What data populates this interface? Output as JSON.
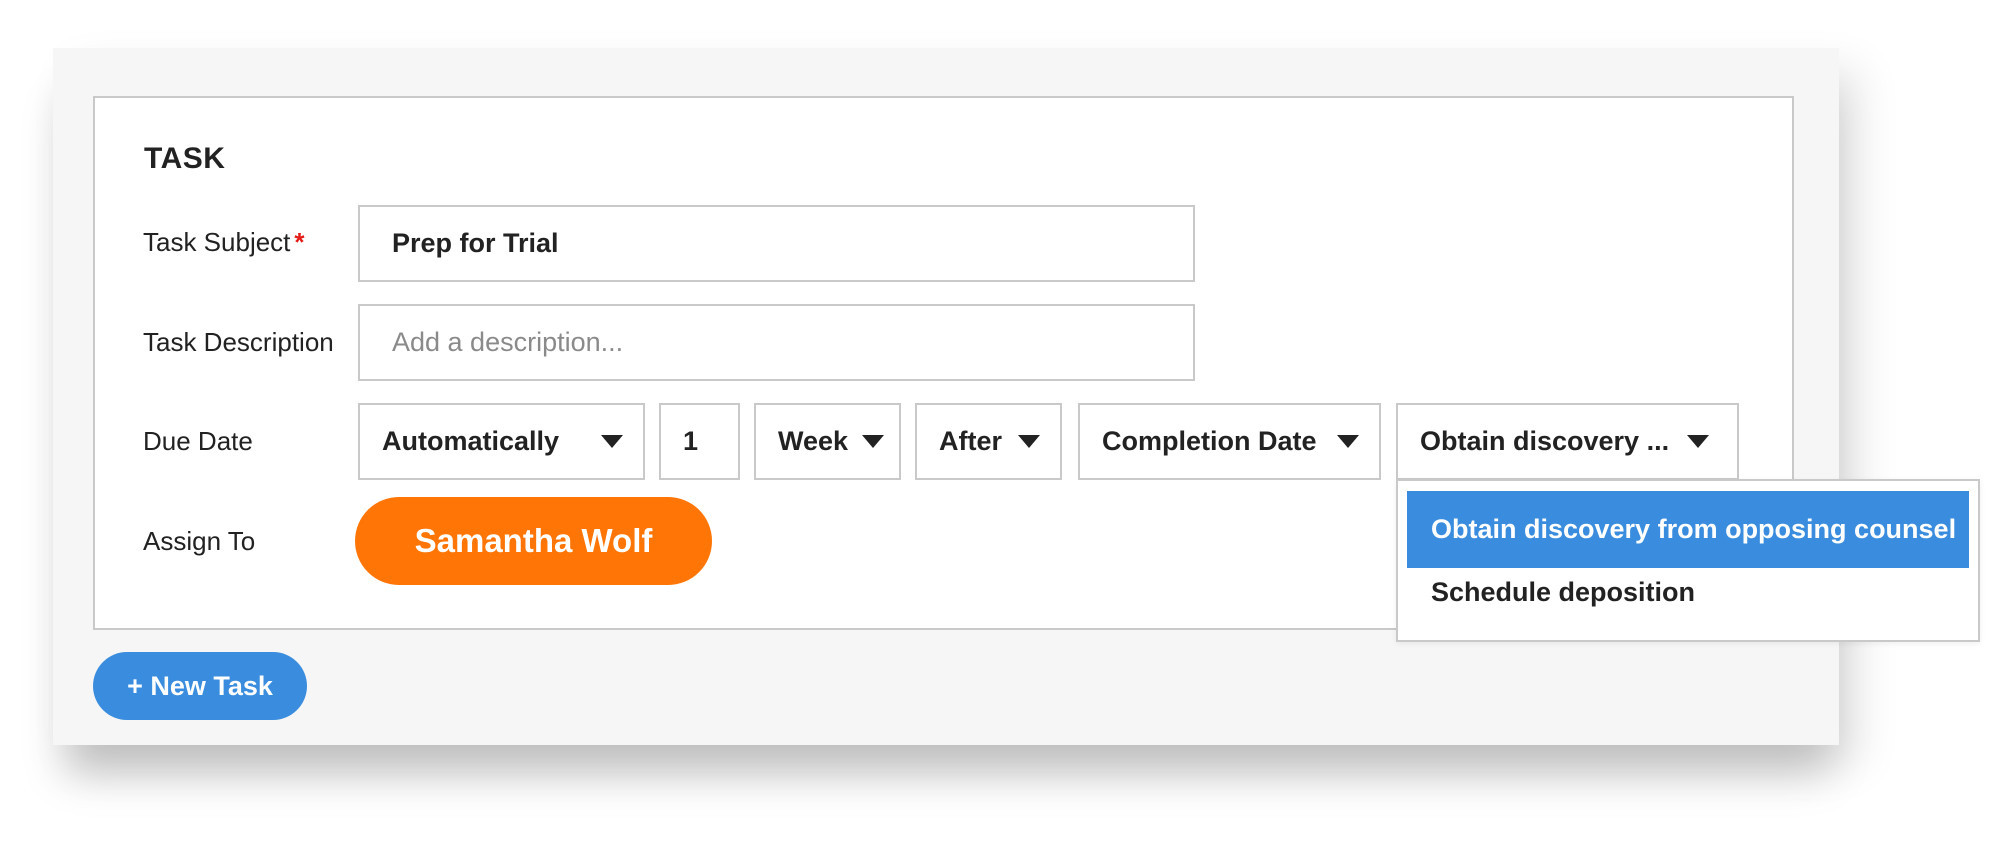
{
  "section_title": "TASK",
  "fields": {
    "subject": {
      "label": "Task Subject",
      "required_marker": "*",
      "value": "Prep for Trial"
    },
    "description": {
      "label": "Task Description",
      "value": "",
      "placeholder": "Add a description..."
    },
    "due_date": {
      "label": "Due Date",
      "mode": "Automatically",
      "amount": "1",
      "unit": "Week",
      "relation": "After",
      "reference": "Completion Date",
      "related_task": "Obtain discovery ..."
    },
    "assign_to": {
      "label": "Assign To",
      "assignee": "Samantha Wolf"
    }
  },
  "related_task_dropdown": {
    "options": [
      {
        "label": "Obtain discovery from opposing counsel",
        "selected": true
      },
      {
        "label": "Schedule deposition",
        "selected": false
      }
    ]
  },
  "actions": {
    "new_task_label": "+ New Task"
  },
  "colors": {
    "accent_blue": "#3a8dde",
    "assignee_orange": "#ff7506",
    "required_red": "#e41b17"
  }
}
